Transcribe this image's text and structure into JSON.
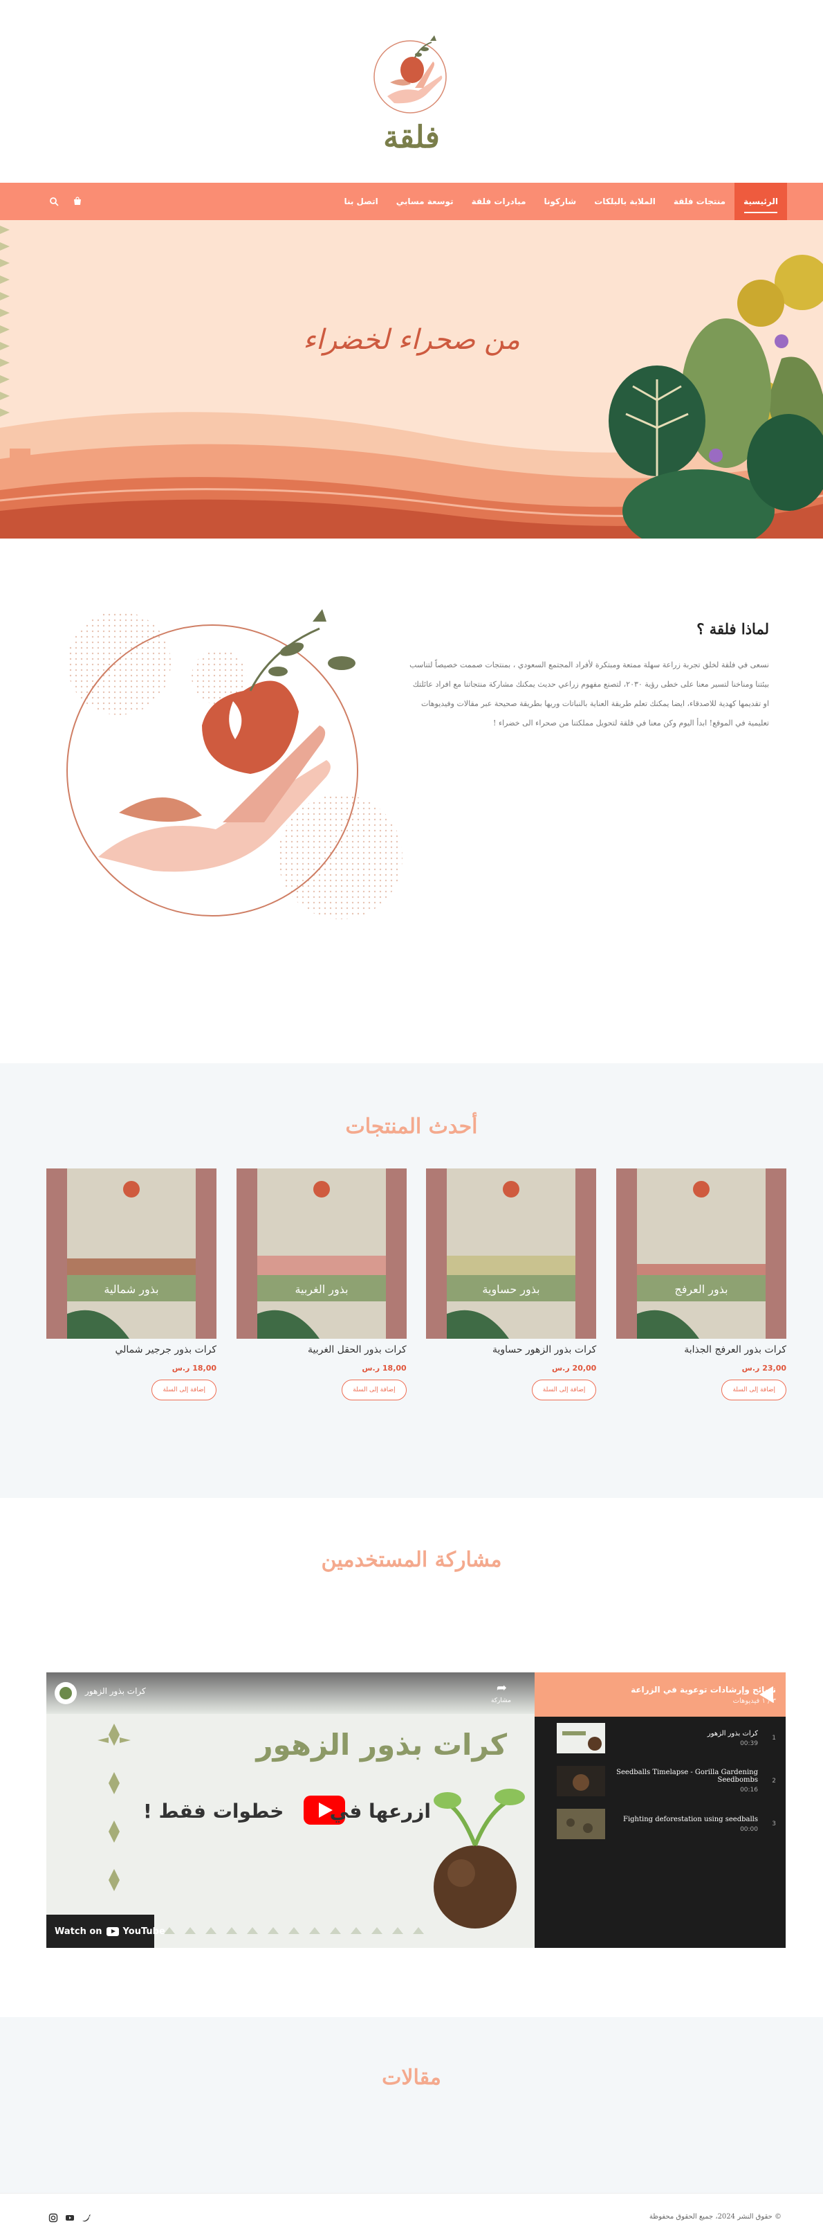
{
  "site": {
    "logo_text": "فلقة",
    "brand_color": "#fa8d73",
    "accent_color": "#ee5b3e",
    "olive_color": "#7a7e4a"
  },
  "nav": {
    "items": [
      {
        "label": "الرئيسية",
        "active": true
      },
      {
        "label": "منتجات فلقة"
      },
      {
        "label": "الملابة بالبلكات"
      },
      {
        "label": "شاركونا"
      },
      {
        "label": "مبادرات فلقة"
      },
      {
        "label": "توسعة مسابي"
      },
      {
        "label": "اتصل بنا"
      }
    ],
    "icons": [
      "search-icon",
      "cart-icon"
    ]
  },
  "hero": {
    "title": "من صحراء لخضراء"
  },
  "why": {
    "title": "لماذا فلقة ؟",
    "body": "نسعى في فلقة لخلق تجربة زراعة سهلة ممتعة ومبتكرة لأفراد المجتمع السعودي ، بمنتجات صممت خصيصاً لتناسب بيئتنا ومناخنا لتسير معنا على خطى رؤية ٢٠٣٠، لتصنع مفهوم زراعي حديث يمكنك مشاركة منتجاتنا مع افراد عائلتك او تقديمها كهدية للاصدقاء، ايضا يمكنك تعلم طريقة العناية بالنباتات وريها بطريقة صحيحة عبر مقالات وفيديوهات تعليمية في الموقع! ابدأ اليوم وكن معنا في فلقة لتحويل مملكتنا من صحراء الى خضراء !"
  },
  "products": {
    "title": "أحدث المنتجات",
    "currency": "ر.س",
    "add_label": "إضافة إلى السلة",
    "items": [
      {
        "name": "كرات بذور العرفج الجذابة",
        "price": "23,00",
        "label": "بذور العرفج"
      },
      {
        "name": "كرات بذور الزهور حساوية",
        "price": "20,00",
        "label": "بذور حساوية"
      },
      {
        "name": "كرات بذور الحقل الغربية",
        "price": "18,00",
        "label": "بذور الغربية"
      },
      {
        "name": "كرات بذور جرجير شمالي",
        "price": "18,00",
        "label": "بذور شمالية"
      }
    ]
  },
  "share": {
    "title": "مشاركة المستخدمين",
    "video": {
      "channel_title": "كرات بذور الزهور",
      "share_label": "مشاركة",
      "headline_1": "كرات بذور الزهور",
      "headline_2": "ازرعها في",
      "headline_3": "خطوات فقط !",
      "watch_on": "Watch on",
      "youtube": "YouTube"
    },
    "playlist": {
      "title": "نصائح وإرشادات توعوية في الزراعة",
      "count": "٣ / ١ فيديوهات",
      "items": [
        {
          "num": "1",
          "title": "كرات بذور الزهور",
          "duration": "00:39"
        },
        {
          "num": "2",
          "title": "Seedballs Timelapse - Gorilla Gardening Seedbombs",
          "duration": "00:16"
        },
        {
          "num": "3",
          "title": "Fighting deforestation using seedballs",
          "duration": "00:00"
        }
      ]
    }
  },
  "articles": {
    "title": "مقالات"
  },
  "footer": {
    "copyright": "© حقوق النشر 2024، جميع الحقوق محفوظة",
    "socials": [
      "instagram-icon",
      "youtube-icon",
      "twitter-icon"
    ]
  }
}
